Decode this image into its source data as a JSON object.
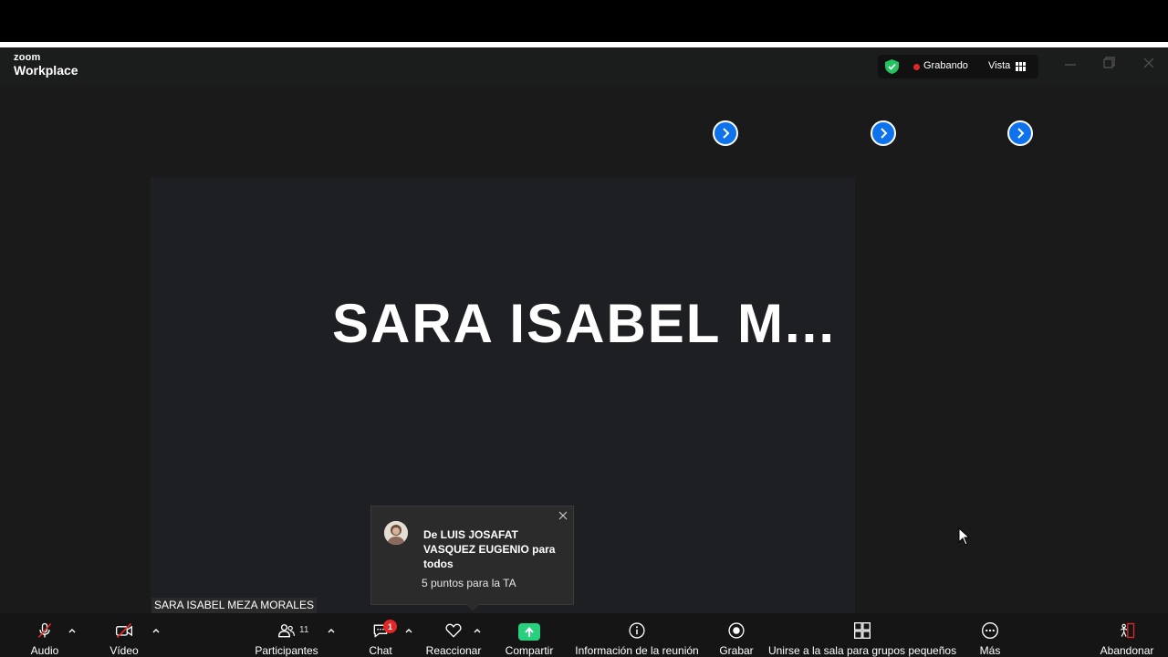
{
  "app": {
    "logo_small": "zoom",
    "logo_large": "Workplace"
  },
  "status": {
    "recording_label": "Grabando",
    "view_label": "Vista"
  },
  "stage": {
    "main_speaker_display": "SARA ISABEL M...",
    "name_tag": "SARA ISABEL MEZA  MORALES"
  },
  "notification": {
    "from": "De LUIS JOSAFAT VASQUEZ EUGENIO para todos",
    "message": "5 puntos para la TA"
  },
  "toolbar": {
    "audio_label": "Audio",
    "video_label": "Vídeo",
    "participants_label": "Participantes",
    "participants_count": "11",
    "chat_label": "Chat",
    "chat_badge": "1",
    "react_label": "Reaccionar",
    "share_label": "Compartir",
    "info_label": "Información de la reunión",
    "record_label": "Grabar",
    "breakout_label": "Unirse a la sala para grupos pequeños",
    "more_label": "Más",
    "leave_label": "Abandonar"
  },
  "colors": {
    "accent_blue": "#0e72ed",
    "share_green": "#26d07c",
    "alert_red": "#e02828",
    "shield_green": "#23c35f"
  }
}
